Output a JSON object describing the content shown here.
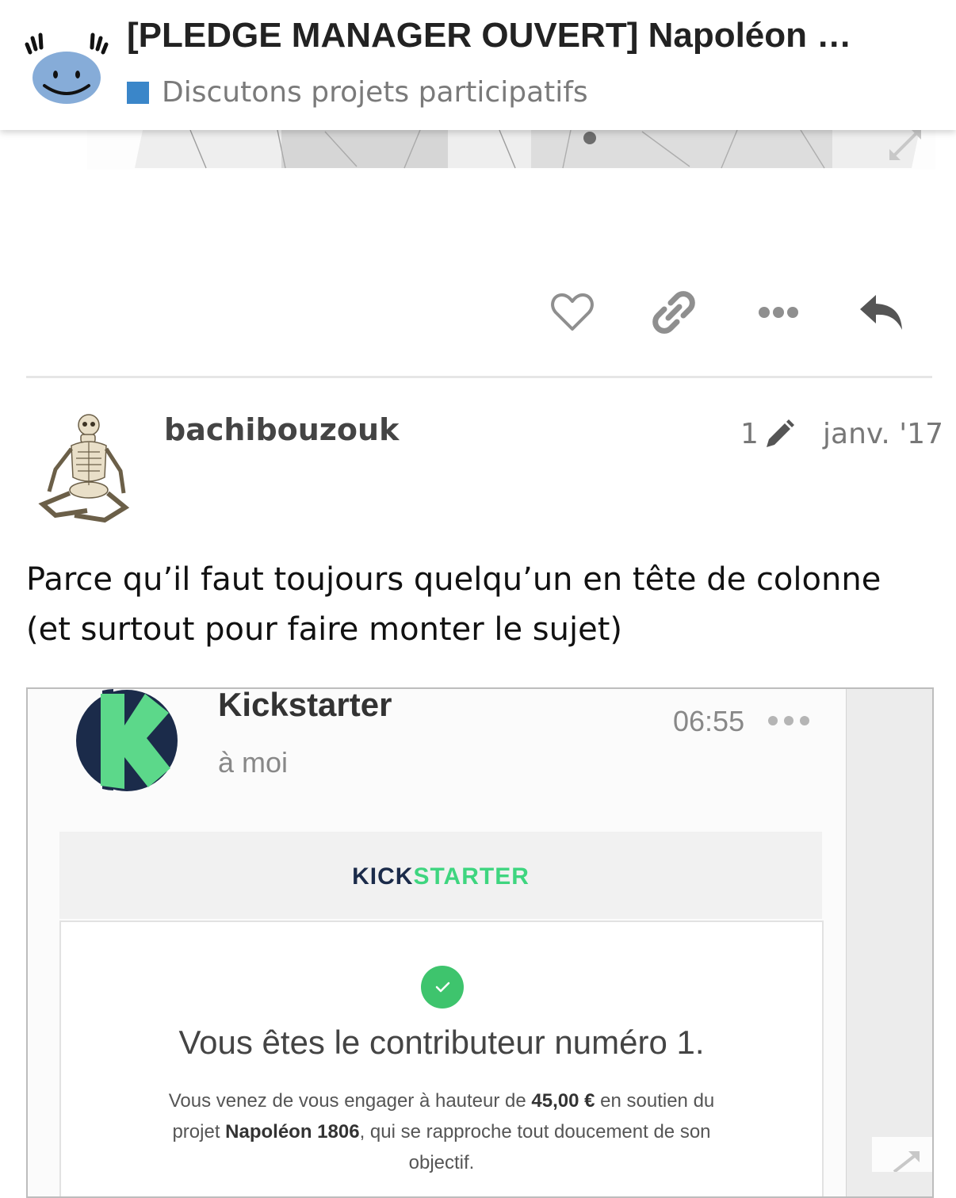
{
  "header": {
    "title": "[PLEDGE MANAGER OUVERT] Napoléon …",
    "category": "Discutons projets participatifs",
    "category_color": "#3a86c9"
  },
  "actions": [
    "heart-icon",
    "link-icon",
    "more-icon",
    "reply-icon"
  ],
  "post": {
    "username": "bachibouzouk",
    "edit_count": "1",
    "date": "janv. '17",
    "body": "Parce qu’il faut toujours quelqu’un en tête de colonne (et surtout pour faire monter le sujet)"
  },
  "embed": {
    "sender": "Kickstarter",
    "recipient": "à moi",
    "time": "06:55",
    "wordmark_kick": "KICK",
    "wordmark_starter": "STARTER",
    "headline": "Vous êtes le contributeur numéro 1.",
    "text_1": "Vous venez de vous engager à hauteur de ",
    "amount": "45,00 €",
    "text_2": " en soutien du projet ",
    "project": "Napoléon 1806",
    "text_3": ", qui se rapproche tout doucement de son objectif.",
    "brand_colors": {
      "green": "#3ed57f",
      "navy": "#1b2b4a"
    }
  }
}
